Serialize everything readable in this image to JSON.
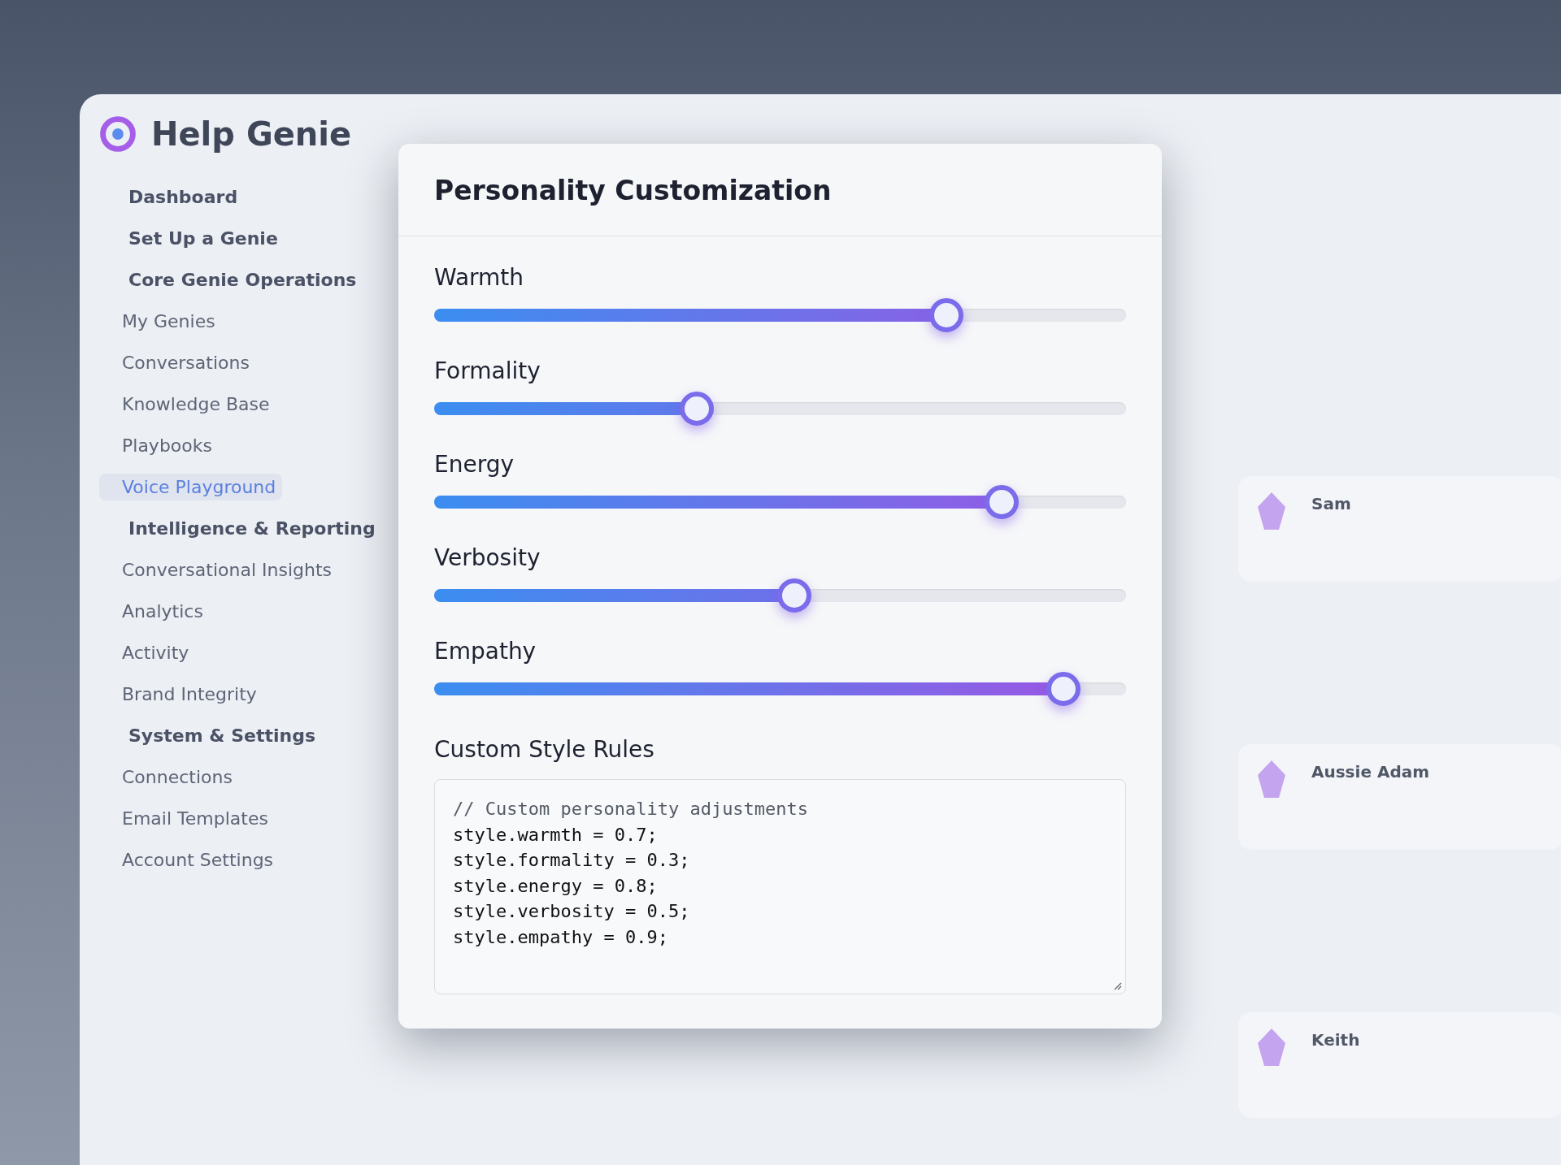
{
  "app": {
    "brand": "Help Genie",
    "sidebar": [
      {
        "label": "Dashboard",
        "kind": "top",
        "selected": false
      },
      {
        "label": "Set Up a Genie",
        "kind": "top",
        "selected": false
      },
      {
        "label": "Core Genie Operations",
        "kind": "top",
        "selected": false
      },
      {
        "label": "My Genies",
        "kind": "sub",
        "selected": false
      },
      {
        "label": "Conversations",
        "kind": "sub",
        "selected": false
      },
      {
        "label": "Knowledge Base",
        "kind": "sub",
        "selected": false
      },
      {
        "label": "Playbooks",
        "kind": "sub",
        "selected": false
      },
      {
        "label": "Voice Playground",
        "kind": "sub",
        "selected": true
      },
      {
        "label": "Intelligence & Reporting",
        "kind": "top",
        "selected": false
      },
      {
        "label": "Conversational Insights",
        "kind": "sub",
        "selected": false
      },
      {
        "label": "Analytics",
        "kind": "sub",
        "selected": false
      },
      {
        "label": "Activity",
        "kind": "sub",
        "selected": false
      },
      {
        "label": "Brand Integrity",
        "kind": "sub",
        "selected": false
      },
      {
        "label": "System & Settings",
        "kind": "top",
        "selected": false
      },
      {
        "label": "Connections",
        "kind": "sub",
        "selected": false
      },
      {
        "label": "Email Templates",
        "kind": "sub",
        "selected": false
      },
      {
        "label": "Account Settings",
        "kind": "sub",
        "selected": false
      }
    ],
    "voices": [
      {
        "name": "Sam"
      },
      {
        "name": "Aussie Adam"
      },
      {
        "name": "Keith"
      }
    ]
  },
  "modal": {
    "title": "Personality Customization",
    "sliders": [
      {
        "label": "Warmth",
        "level": 0.74
      },
      {
        "label": "Formality",
        "level": 0.38
      },
      {
        "label": "Energy",
        "level": 0.82
      },
      {
        "label": "Verbosity",
        "level": 0.52
      },
      {
        "label": "Empathy",
        "level": 0.91
      }
    ],
    "rules_label": "Custom Style Rules",
    "rules": [
      "// Custom personality adjustments",
      "style.warmth = 0.7;",
      "style.formality = 0.3;",
      "style.energy = 0.8;",
      "style.verbosity = 0.5;",
      "style.empathy = 0.9;"
    ]
  }
}
